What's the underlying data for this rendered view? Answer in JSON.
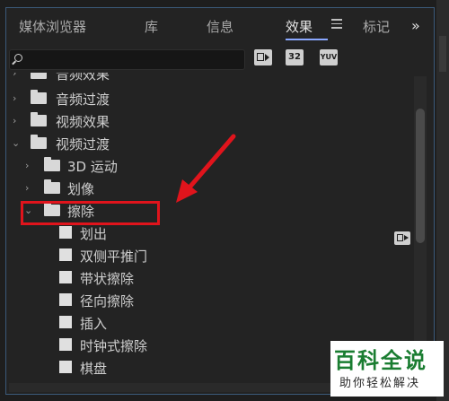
{
  "tabs": [
    {
      "label": "媒体浏览器",
      "active": false
    },
    {
      "label": "库",
      "active": false
    },
    {
      "label": "信息",
      "active": false
    },
    {
      "label": "效果",
      "active": true
    },
    {
      "label": "标记",
      "active": false
    }
  ],
  "toolbar": {
    "search_value": "",
    "btn_32": "32",
    "btn_yuv": "YUV"
  },
  "tree": {
    "audio_effects": "音频效果",
    "audio_transitions": "音频过渡",
    "video_effects": "视频效果",
    "video_transitions": "视频过渡",
    "motion_3d": "3D 运动",
    "image": "划像",
    "wipe": "擦除",
    "wipe_items": [
      "划出",
      "双侧平推门",
      "带状擦除",
      "径向擦除",
      "插入",
      "时钟式擦除",
      "棋盘"
    ]
  },
  "watermark": {
    "main": "百科全说",
    "sub": "助你轻松解决"
  },
  "colors": {
    "highlight": "#e0141c",
    "accent": "#8aa8ff",
    "panel_border": "#3b5a7a"
  }
}
